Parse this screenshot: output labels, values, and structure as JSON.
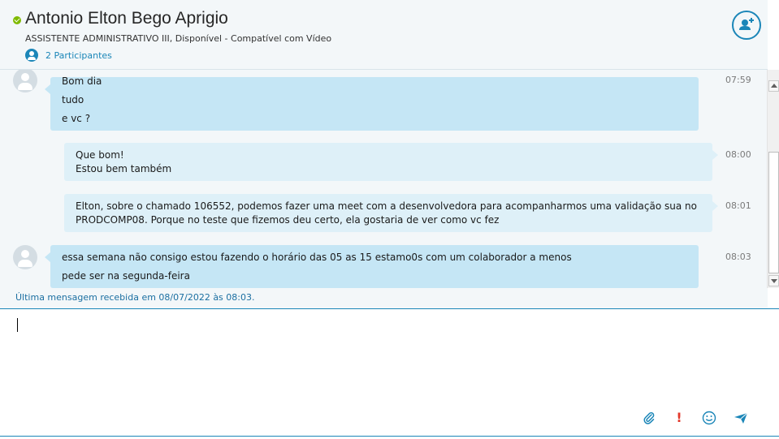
{
  "contact": {
    "name": "Antonio Elton Bego Aprigio",
    "status_line": "ASSISTENTE ADMINISTRATIVO III,  Disponível - Compatível com Vídeo",
    "participants_label": "2 Participantes"
  },
  "messages": [
    {
      "sender": "contact",
      "lines": [
        "Bom dia",
        "tudo",
        "e vc ?"
      ],
      "time": "07:59"
    },
    {
      "sender": "self",
      "lines": [
        "Que bom!",
        "Estou bem também"
      ],
      "time": "08:00"
    },
    {
      "sender": "self",
      "lines": [
        "Elton, sobre o chamado 106552, podemos fazer uma meet com a desenvolvedora para acompanharmos uma validação sua no",
        "PRODCOMP08. Porque no teste que fizemos deu certo, ela gostaria de ver como vc fez"
      ],
      "time": "08:01"
    },
    {
      "sender": "contact",
      "lines": [
        "essa semana não consigo estou fazendo o horário das 05 as 15 estamo0s com um colaborador a menos",
        "pede ser na segunda-feira"
      ],
      "time": "08:03"
    }
  ],
  "last_message_notice": "Última mensagem recebida em 08/07/2022 às 08:03.",
  "colors": {
    "accent": "#1b86b8",
    "presence": "#7fba00",
    "incoming_bubble": "#c5e6f5",
    "outgoing_bubble": "#def0f8",
    "importance": "#e3382b"
  },
  "icons": {
    "presence": "available-icon",
    "participants": "participants-icon",
    "add": "add-people-icon",
    "attach": "paperclip-icon",
    "importance": "exclamation-icon",
    "emoticon": "smiley-icon",
    "send": "send-icon"
  }
}
